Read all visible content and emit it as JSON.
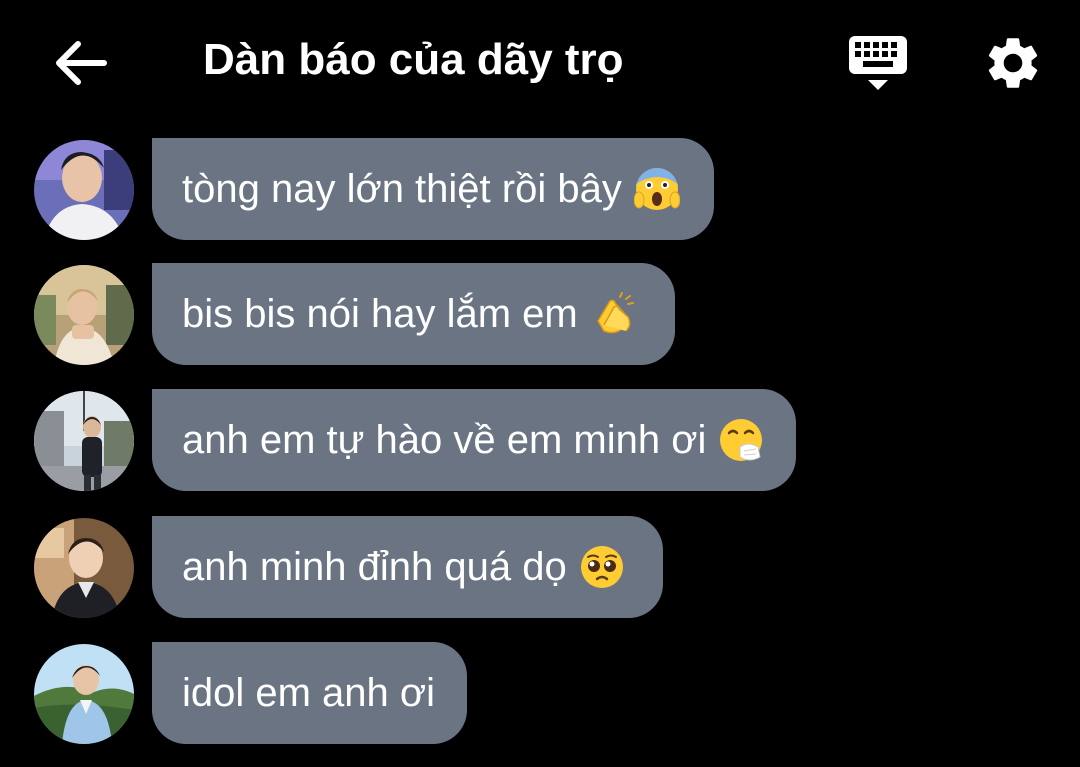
{
  "header": {
    "title": "Dàn báo của dãy trọ",
    "back_icon": "arrow-left-icon",
    "keyboard_icon": "keyboard-icon",
    "settings_icon": "gear-icon"
  },
  "colors": {
    "background": "#000000",
    "bubble": "#6b7482",
    "text": "#ffffff"
  },
  "messages": [
    {
      "text": "tòng nay lớn thiệt rồi bây",
      "emoji": "face-screaming-in-fear-emoji"
    },
    {
      "text": "bis bis nói hay lắm em",
      "emoji": "clapping-hands-emoji"
    },
    {
      "text": "anh em tự hào về em minh ơi",
      "emoji": "sneezing-face-emoji"
    },
    {
      "text": "anh minh đỉnh quá dọ",
      "emoji": "pleading-face-emoji"
    },
    {
      "text": "idol em anh ơi",
      "emoji": ""
    }
  ]
}
